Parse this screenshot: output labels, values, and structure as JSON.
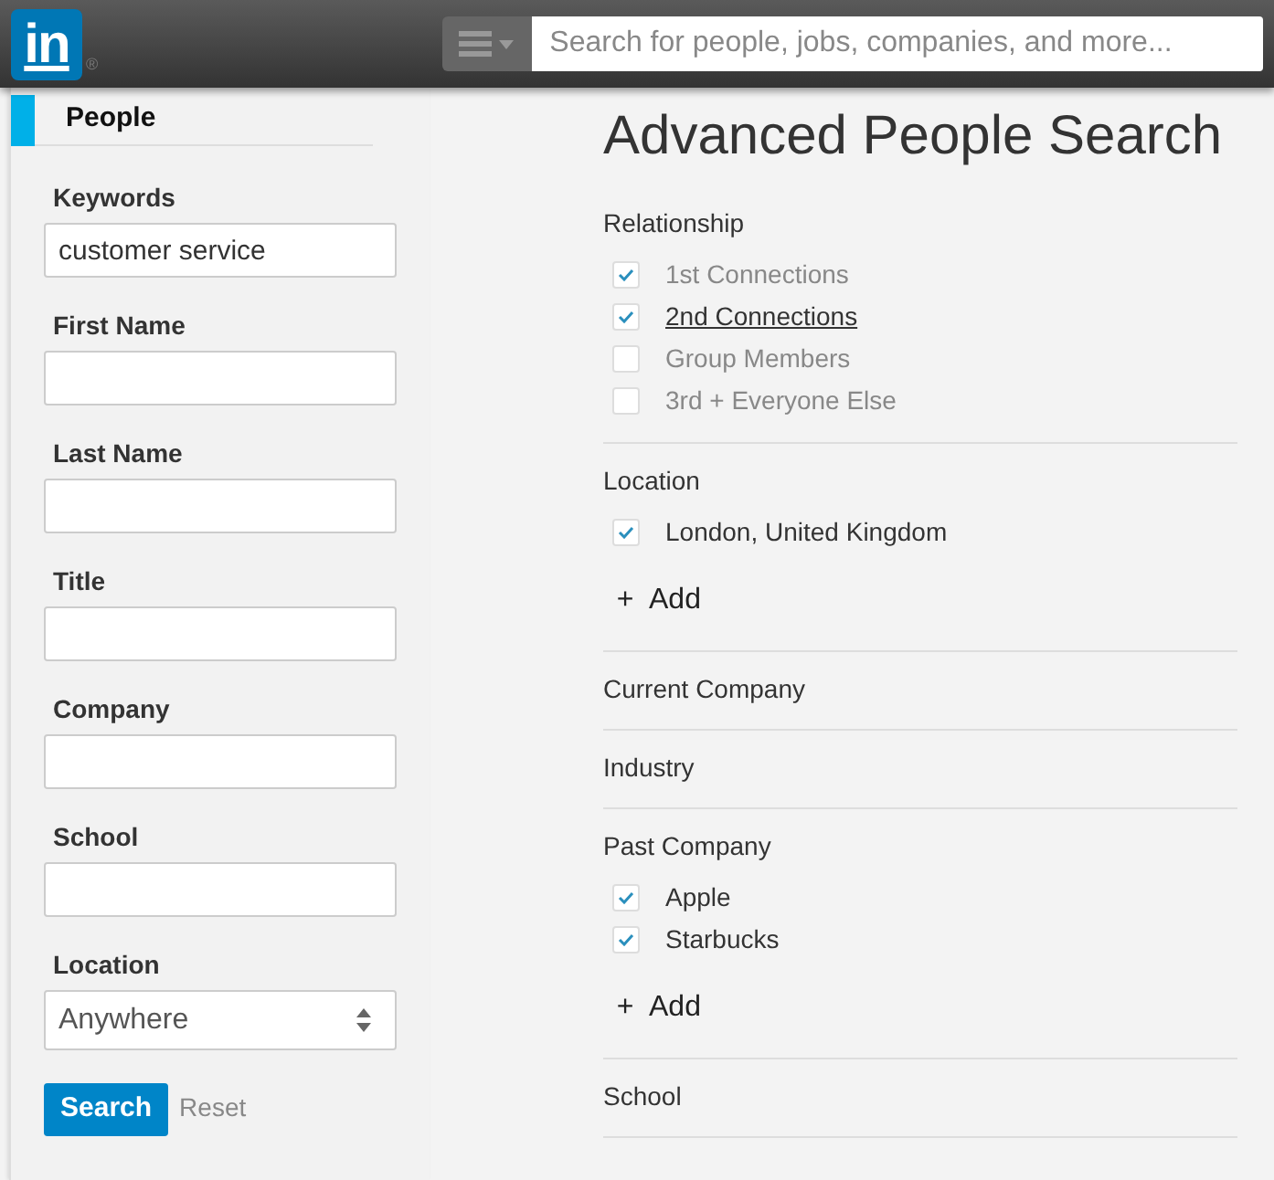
{
  "header": {
    "logo_text": "in",
    "logo_mark": "®",
    "search": {
      "placeholder": "Search for people, jobs, companies, and more..."
    }
  },
  "sidebar": {
    "tab": {
      "label": "People",
      "selected": true
    },
    "fields": [
      {
        "kind": "text",
        "label": "Keywords",
        "value": "customer service"
      },
      {
        "kind": "text",
        "label": "First Name"
      },
      {
        "kind": "text",
        "label": "Last Name"
      },
      {
        "kind": "text",
        "label": "Title"
      },
      {
        "kind": "text",
        "label": "Company"
      },
      {
        "kind": "text",
        "label": "School"
      },
      {
        "kind": "select",
        "label": "Location",
        "value": "Anywhere"
      }
    ],
    "search_button": "Search",
    "reset_link": "Reset"
  },
  "main": {
    "title": "Advanced People Search",
    "sections": [
      {
        "title": "Relationship",
        "options": [
          {
            "label": "1st Connections",
            "checked": true,
            "dimmed": true,
            "hovered": false
          },
          {
            "label": "2nd Connections",
            "checked": true,
            "dimmed": false,
            "hovered": true
          },
          {
            "label": "Group Members",
            "checked": false,
            "dimmed": true,
            "hovered": false
          },
          {
            "label": "3rd + Everyone Else",
            "checked": false,
            "dimmed": true,
            "hovered": false
          }
        ]
      },
      {
        "title": "Location",
        "options": [
          {
            "label": "London, United Kingdom",
            "checked": true,
            "dimmed": false,
            "hovered": false
          }
        ],
        "add": {
          "icon": "+",
          "label": "Add"
        }
      },
      {
        "title": "Current Company"
      },
      {
        "title": "Industry"
      },
      {
        "title": "Past Company",
        "options": [
          {
            "label": "Apple",
            "checked": true,
            "dimmed": false,
            "hovered": false
          },
          {
            "label": "Starbucks",
            "checked": true,
            "dimmed": false,
            "hovered": false
          }
        ],
        "add": {
          "icon": "+",
          "label": "Add"
        }
      },
      {
        "title": "School"
      }
    ]
  }
}
